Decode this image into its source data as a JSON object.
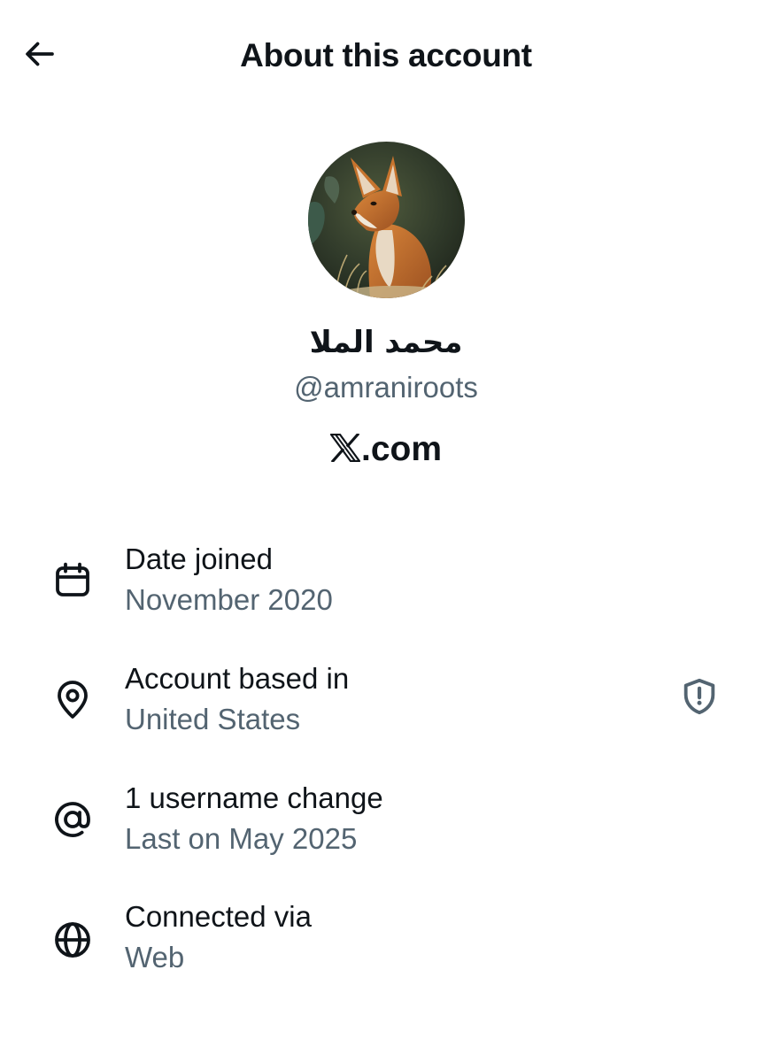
{
  "header": {
    "title": "About this account",
    "back_icon": "arrow-left-icon"
  },
  "profile": {
    "display_name": "محمد الملا",
    "handle": "@amraniroots",
    "avatar_icon": "fox-avatar",
    "platform_text": ".com",
    "platform_logo": "x-logo-icon"
  },
  "details": [
    {
      "icon": "calendar-icon",
      "label": "Date joined",
      "value": "November 2020"
    },
    {
      "icon": "location-pin-icon",
      "label": "Account based in",
      "value": "United States",
      "trailing_icon": "shield-alert-icon"
    },
    {
      "icon": "at-sign-icon",
      "label": "1 username change",
      "value": "Last on May 2025"
    },
    {
      "icon": "globe-icon",
      "label": "Connected via",
      "value": "Web"
    }
  ],
  "colors": {
    "text_primary": "#0f1419",
    "text_secondary": "#536471",
    "background": "#ffffff"
  }
}
